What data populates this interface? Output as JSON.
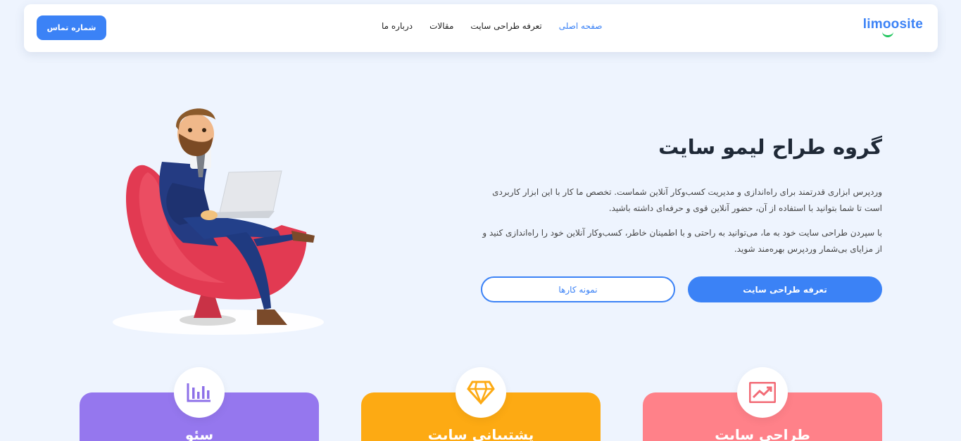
{
  "header": {
    "logo": "limoosite",
    "nav": [
      "صفحه اصلی",
      "تعرفه طراحی سایت",
      "مقالات",
      "درباره ما"
    ],
    "contact_button": "شماره تماس"
  },
  "hero": {
    "title": "گروه طراح لیمو سایت",
    "paragraph1": "وردپرس ابزاری قدرتمند برای راه‌اندازی و مدیریت کسب‌وکار آنلاین شماست. تخصص ما کار با این ابزار کاربردی است تا شما بتوانید با استفاده از آن، حضور آنلاین قوی و حرفه‌ای داشته باشید.",
    "paragraph2": "با سپردن طراحی سایت خود به ما، می‌توانید به راحتی و با اطمینان خاطر، کسب‌وکار آنلاین خود را راه‌اندازی کنید و از مزایای بی‌شمار وردپرس بهره‌مند شوید.",
    "primary_button": "تعرفه طراحی سایت",
    "secondary_button": "نمونه کارها"
  },
  "cards": [
    {
      "title": "طراحی سایت",
      "icon": "chart-trend-icon",
      "color": "#ff8189"
    },
    {
      "title": "پشتیبانی سایت",
      "icon": "diamond-icon",
      "color": "#fdaa13"
    },
    {
      "title": "سئو",
      "icon": "bar-chart-icon",
      "color": "#9577ee"
    }
  ],
  "colors": {
    "accent": "#3b82f6",
    "background": "#eef4fe"
  }
}
